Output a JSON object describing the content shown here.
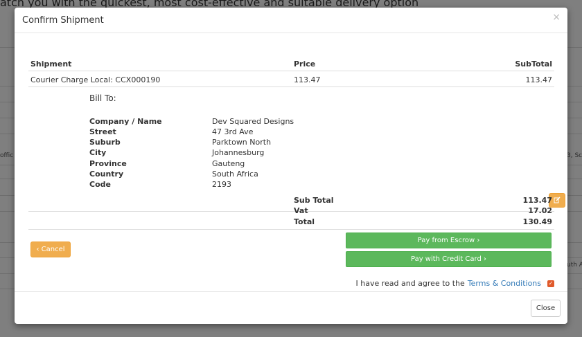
{
  "background": {
    "headline": "atch you with the quickest, most cost-effective and suitable delivery option",
    "snippet_left": "offic",
    "snippet_right_1": "3, Sc",
    "snippet_right_2": "uth A"
  },
  "modal": {
    "title": "Confirm Shipment",
    "close_glyph": "×"
  },
  "shipment_table": {
    "headers": [
      "Shipment",
      "Price",
      "SubTotal"
    ],
    "rows": [
      [
        "Courier Charge Local: CCX000190",
        "113.47",
        "113.47"
      ]
    ]
  },
  "bill_to": {
    "title": "Bill To:",
    "fields": [
      {
        "label": "Company / Name",
        "value": "Dev Squared Designs"
      },
      {
        "label": "Street",
        "value": "47 3rd Ave"
      },
      {
        "label": "Suburb",
        "value": "Parktown North"
      },
      {
        "label": "City",
        "value": "Johannesburg"
      },
      {
        "label": "Province",
        "value": "Gauteng"
      },
      {
        "label": "Country",
        "value": "South Africa"
      },
      {
        "label": "Code",
        "value": "2193"
      }
    ],
    "edit_icon": "edit-icon"
  },
  "totals": [
    {
      "label": "Sub Total",
      "value": "113.47"
    },
    {
      "label": "Vat",
      "value": "17.02"
    },
    {
      "label": "Total",
      "value": "130.49"
    }
  ],
  "actions": {
    "cancel_label": "‹ Cancel",
    "pay_escrow_label": "Pay from Escrow ›",
    "pay_card_label": "Pay with Credit Card ›"
  },
  "terms": {
    "text": "I have read and agree to the",
    "link": "Terms & Conditions",
    "checked": true
  },
  "footer": {
    "close_label": "Close"
  },
  "colors": {
    "warning": "#f0ad4e",
    "success": "#5cb85c",
    "link": "#337ab7",
    "checkbox": "#e05a2b"
  }
}
